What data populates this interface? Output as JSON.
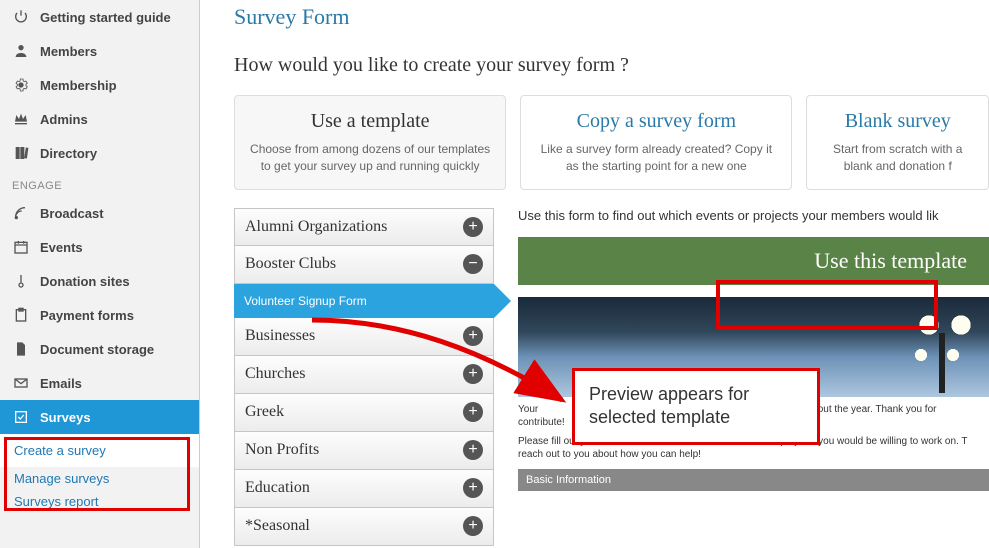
{
  "sidebar": {
    "items": [
      {
        "label": "Getting started guide",
        "icon": "power-icon"
      },
      {
        "label": "Members",
        "icon": "user-icon"
      },
      {
        "label": "Membership",
        "icon": "gear-icon"
      },
      {
        "label": "Admins",
        "icon": "crown-icon"
      },
      {
        "label": "Directory",
        "icon": "book-icon"
      }
    ],
    "engage_heading": "ENGAGE",
    "engage_items": [
      {
        "label": "Broadcast",
        "icon": "wifi-icon"
      },
      {
        "label": "Events",
        "icon": "calendar-icon"
      },
      {
        "label": "Donation sites",
        "icon": "thermometer-icon"
      },
      {
        "label": "Payment forms",
        "icon": "clipboard-icon"
      },
      {
        "label": "Document storage",
        "icon": "file-icon"
      },
      {
        "label": "Emails",
        "icon": "envelope-icon"
      },
      {
        "label": "Surveys",
        "icon": "check-icon",
        "active": true
      }
    ],
    "sub_items": [
      {
        "label": "Create a survey"
      },
      {
        "label": "Manage surveys"
      },
      {
        "label": "Surveys report"
      }
    ]
  },
  "page_title": "Survey Form",
  "question": "How would you like to create your survey form ?",
  "cards": [
    {
      "title": "Use a template",
      "desc": "Choose from among dozens of our templates to get your survey up and running quickly",
      "selected": true
    },
    {
      "title": "Copy a survey form",
      "desc": "Like a survey form already created? Copy it as the starting point for a new one"
    },
    {
      "title": "Blank survey",
      "desc": "Start from scratch with a blank and donation f"
    }
  ],
  "accordion": [
    {
      "label": "Alumni Organizations",
      "expanded": false
    },
    {
      "label": "Booster Clubs",
      "expanded": true,
      "child": "Volunteer Signup Form"
    },
    {
      "label": "Businesses",
      "expanded": false
    },
    {
      "label": "Churches",
      "expanded": false
    },
    {
      "label": "Greek",
      "expanded": false
    },
    {
      "label": "Non Profits",
      "expanded": false
    },
    {
      "label": "Education",
      "expanded": false
    },
    {
      "label": "*Seasonal",
      "expanded": false
    }
  ],
  "preview": {
    "desc": "Use this form to find out which events or projects your members would lik",
    "button": "Use this template",
    "p1a": "Your",
    "p1b": " throughout the year. Thank you for",
    "p1c": "contribute!",
    "p2": "Please fill out your information and select the which events/projects you would be willing to work on.  T",
    "p2b": "reach out to you about how you can help!",
    "section": "Basic Information"
  },
  "annotations": {
    "callout": "Preview appears for selected template"
  }
}
